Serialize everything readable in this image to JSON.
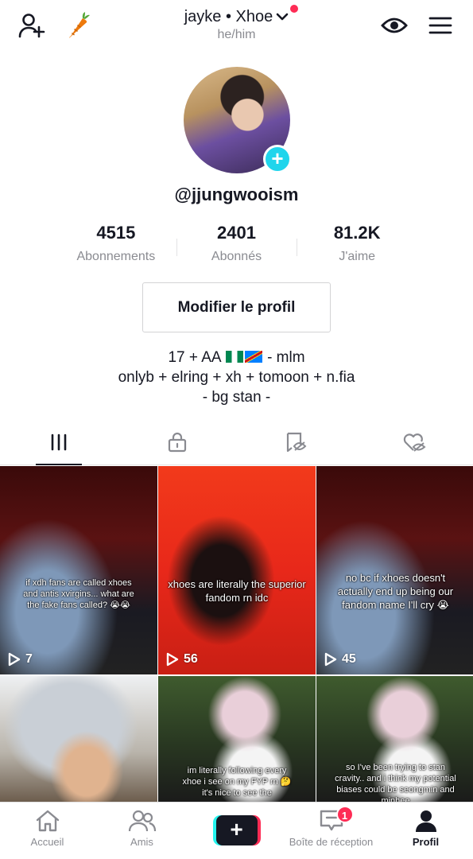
{
  "header": {
    "name": "jayke • Xhoe",
    "pronouns": "he/him",
    "icons": [
      "add-user-icon",
      "carrot-icon",
      "chevron-down-icon",
      "eye-icon",
      "menu-icon"
    ]
  },
  "profile": {
    "username": "@jjungwooism",
    "stats": [
      {
        "value": "4515",
        "label": "Abonnements"
      },
      {
        "value": "2401",
        "label": "Abonnés"
      },
      {
        "value": "81.2K",
        "label": "J'aime"
      }
    ],
    "edit_label": "Modifier le profil",
    "bio": {
      "line1_prefix": "17 + AA",
      "line1_suffix": "- mlm",
      "line2": "onlyb + elring + xh + tomoon + n.fia",
      "line3": "- bg stan -"
    }
  },
  "tabs": [
    "videos-grid-icon",
    "lock-icon",
    "repost-icon",
    "liked-hidden-icon"
  ],
  "videos": [
    {
      "caption": "if xdh fans are called xhoes and antis xvirgins... what are the fake fans called? 😭😭",
      "views": "7"
    },
    {
      "caption": "xhoes are literally the superior fandom rn idc",
      "views": "56"
    },
    {
      "caption": "no bc if xhoes doesn't actually end up being our fandom name I'll cry 😭",
      "views": "45"
    },
    {
      "caption": "",
      "views": ""
    },
    {
      "caption": "im literally following every xhoe i see on my FYP rn 🤔 it's nice to see the",
      "views": ""
    },
    {
      "caption": "so I've been trying to stan cravity.. and i think my potential biases could be seongmin and minhee",
      "views": ""
    }
  ],
  "nav": {
    "home": "Accueil",
    "friends": "Amis",
    "inbox": "Boîte de réception",
    "inbox_badge": "1",
    "profile": "Profil"
  },
  "colors": {
    "accent": "#fe2c55",
    "cyan": "#20d5ec",
    "text": "#161823",
    "muted": "#8a8b91"
  }
}
